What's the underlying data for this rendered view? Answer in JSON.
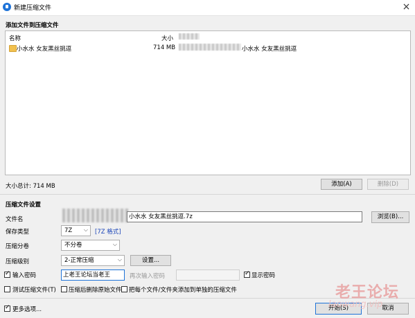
{
  "window": {
    "title": "新建压缩文件",
    "close": "×"
  },
  "files": {
    "section_title": "添加文件到压缩文件",
    "columns": {
      "name": "名称",
      "size": "大小"
    },
    "rows": [
      {
        "name": "小水水 女友黑丝挑逗",
        "size": "714 MB",
        "folder": "小水水 女友黑丝挑逗"
      }
    ],
    "total": "大小总计: 714 MB",
    "add_button": "添加(A)",
    "delete_button": "删除(D)"
  },
  "settings": {
    "section_title": "压缩文件设置",
    "filename_label": "文件名",
    "filename_value": "小水水 女友黑丝挑逗.7z",
    "browse_button": "浏览(B)...",
    "type_label": "保存类型",
    "type_value": "7Z",
    "type_link": "[7Z 格式]",
    "split_label": "压缩分卷",
    "split_value": "不分卷",
    "level_label": "压缩级别",
    "level_value": "2-正常压缩",
    "settings_button": "设置...",
    "password_label": "输入密码",
    "password_value": "上老王论坛当老王",
    "reenter_label": "再次输入密码",
    "show_password_label": "显示密码",
    "test_label": "测试压缩文件(T)",
    "delete_after_label": "压缩后删除原始文件",
    "separate_label": "把每个文件/文件夹添加到单独的压缩文件"
  },
  "footer": {
    "more_options": "更多选项...",
    "start_button": "开始(S)",
    "cancel_button": "取消"
  },
  "watermark": {
    "main": "老王论坛",
    "sub": "laowang.vip"
  },
  "icons": {
    "dropdown": "chevron-down-icon",
    "folder": "folder-icon",
    "check": "check-icon"
  },
  "colors": {
    "accent": "#1e73d8",
    "link": "#1a44b8",
    "folder": "#f2c14e"
  }
}
